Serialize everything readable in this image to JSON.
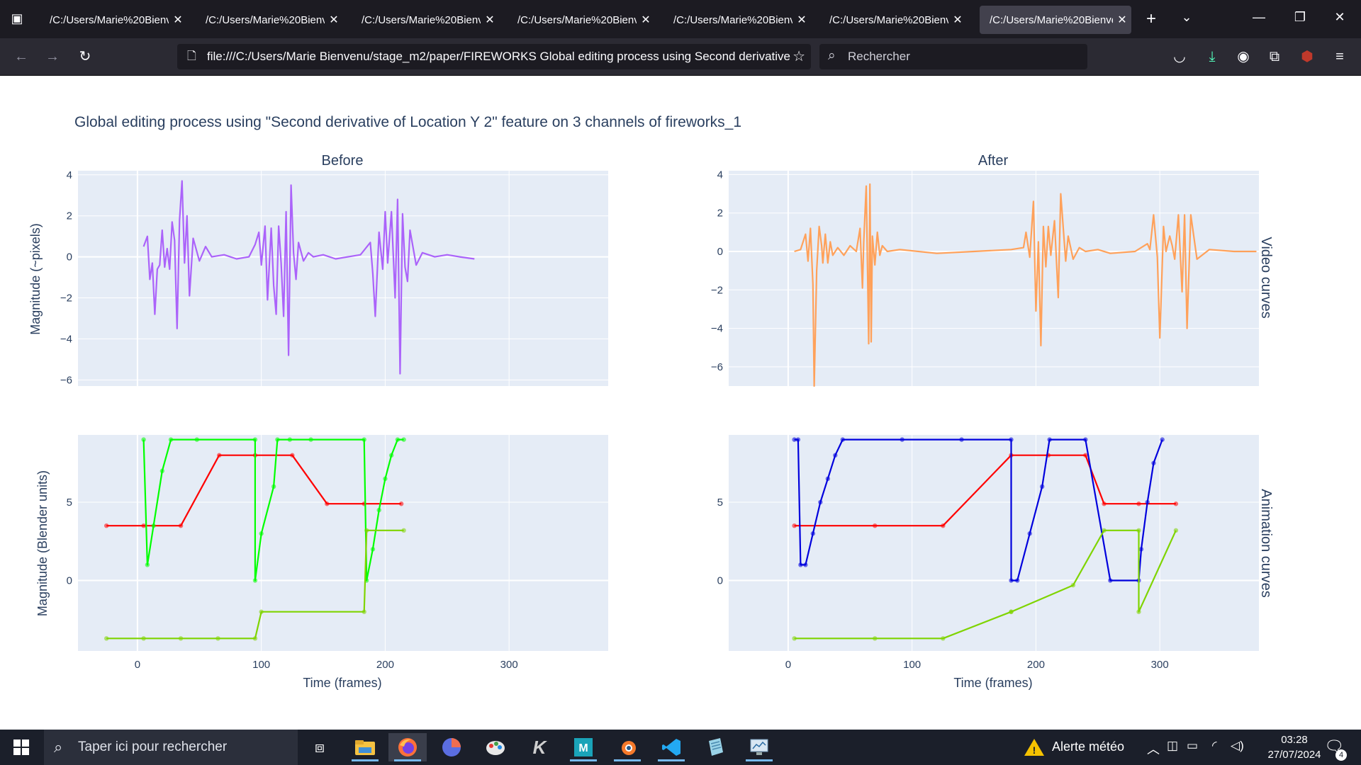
{
  "tabs": [
    {
      "label": "/C:/Users/Marie%20Bienve"
    },
    {
      "label": "/C:/Users/Marie%20Bienve"
    },
    {
      "label": "/C:/Users/Marie%20Bienve"
    },
    {
      "label": "/C:/Users/Marie%20Bienve"
    },
    {
      "label": "/C:/Users/Marie%20Bienve"
    },
    {
      "label": "/C:/Users/Marie%20Bienve"
    },
    {
      "label": "/C:/Users/Marie%20Bienve"
    }
  ],
  "active_tab_index": 6,
  "nav": {
    "url": "file:///C:/Users/Marie Bienvenu/stage_m2/paper/FIREWORKS Global editing process using Second derivative",
    "search_placeholder": "Rechercher"
  },
  "figure": {
    "title": "Global editing process using \"Second derivative of Location Y 2\" feature on 3 channels of fireworks_1",
    "col_titles": [
      "Before",
      "After"
    ],
    "row_titles": [
      "Video curves",
      "Animation curves"
    ],
    "ylabel_top": "Magnitude (~pixels)",
    "ylabel_bottom": "Magnitude (Blender units)",
    "xlabel": "Time (frames)"
  },
  "chart_data": [
    {
      "type": "line",
      "panel": "Before / Video curves",
      "color": "#ab63fa",
      "xlim": [
        -48,
        380
      ],
      "ylim": [
        -6.3,
        4.2
      ],
      "xticks": [
        0,
        100,
        200,
        300
      ],
      "yticks": [
        -6,
        -4,
        -2,
        0,
        2,
        4
      ],
      "series": [
        {
          "x": [
            5,
            8,
            10,
            12,
            14,
            16,
            18,
            20,
            22,
            24,
            26,
            28,
            30,
            32,
            34,
            36,
            38,
            40,
            42,
            45,
            50,
            55,
            60,
            70,
            80,
            90,
            95,
            98,
            100,
            103,
            105,
            108,
            110,
            112,
            114,
            116,
            118,
            120,
            122,
            124,
            126,
            128,
            130,
            134,
            138,
            142,
            150,
            160,
            170,
            180,
            188,
            190,
            192,
            195,
            198,
            200,
            202,
            205,
            208,
            210,
            212,
            214,
            216,
            218,
            220,
            225,
            230,
            240,
            250,
            260,
            272
          ],
          "y": [
            0.5,
            1.0,
            -1.1,
            -0.3,
            -2.8,
            -0.6,
            -0.4,
            1.3,
            -0.5,
            0.4,
            -0.6,
            1.7,
            0.8,
            -3.5,
            1.8,
            3.7,
            -0.3,
            2.0,
            -1.9,
            0.9,
            -0.2,
            0.5,
            0.0,
            0.1,
            -0.1,
            0.0,
            0.6,
            1.2,
            -0.4,
            1.5,
            -2.1,
            1.4,
            -1.4,
            -2.8,
            1.5,
            -0.3,
            -2.9,
            2.2,
            -4.8,
            3.5,
            0.2,
            -1.1,
            0.7,
            -0.2,
            0.2,
            0.0,
            0.1,
            -0.1,
            0.0,
            0.1,
            0.7,
            -0.8,
            -2.9,
            1.2,
            -0.6,
            2.2,
            -0.3,
            2.2,
            -2.0,
            2.8,
            -5.7,
            2.1,
            -0.5,
            -1.2,
            1.3,
            -0.4,
            0.2,
            0.0,
            0.1,
            0.0,
            -0.1
          ]
        }
      ]
    },
    {
      "type": "line",
      "panel": "After / Video curves",
      "color": "#ffa15a",
      "xlim": [
        -48,
        380
      ],
      "ylim": [
        -7.0,
        4.2
      ],
      "xticks": [
        0,
        100,
        200,
        300
      ],
      "yticks": [
        -6,
        -4,
        -2,
        0,
        2,
        4
      ],
      "series": [
        {
          "x": [
            5,
            10,
            14,
            16,
            18,
            20,
            21,
            23,
            25,
            27,
            28,
            30,
            32,
            34,
            36,
            40,
            45,
            50,
            55,
            58,
            60,
            61,
            63,
            65,
            66,
            67,
            68,
            70,
            72,
            74,
            76,
            80,
            90,
            120,
            150,
            180,
            190,
            192,
            195,
            198,
            200,
            202,
            204,
            206,
            208,
            210,
            212,
            215,
            218,
            220,
            224,
            226,
            230,
            235,
            240,
            250,
            260,
            280,
            290,
            292,
            295,
            298,
            300,
            303,
            305,
            308,
            310,
            312,
            315,
            318,
            320,
            322,
            325,
            330,
            340,
            360,
            378
          ],
          "y": [
            0,
            0.1,
            0.9,
            -0.5,
            1.2,
            -1.7,
            -7.0,
            -1.0,
            1.3,
            0.3,
            -0.6,
            0.9,
            -0.6,
            0.5,
            -0.2,
            0.2,
            -0.2,
            0.3,
            0.0,
            1.2,
            -1.9,
            0.5,
            3.4,
            -4.8,
            3.5,
            -4.7,
            0.8,
            -0.7,
            1.0,
            -0.2,
            0.3,
            0.0,
            0.1,
            -0.1,
            0.0,
            0.1,
            0.2,
            1.0,
            -0.3,
            2.6,
            -3.1,
            0.5,
            -4.9,
            1.3,
            -0.8,
            1.3,
            -0.2,
            1.6,
            -2.4,
            3.0,
            -0.5,
            0.8,
            -0.4,
            0.2,
            0.0,
            0.1,
            -0.1,
            0.0,
            0.4,
            0.1,
            1.9,
            -0.3,
            -4.5,
            1.3,
            0.0,
            0.8,
            0.3,
            -0.4,
            1.9,
            -2.1,
            1.9,
            -4.0,
            1.9,
            -0.4,
            0.1,
            0.0,
            0.0
          ]
        }
      ]
    },
    {
      "type": "line",
      "panel": "Before / Animation curves",
      "xlim": [
        -48,
        380
      ],
      "ylim": [
        -4.5,
        9.3
      ],
      "xticks": [
        0,
        100,
        200,
        300
      ],
      "yticks": [
        0,
        5
      ],
      "series": [
        {
          "color": "#ff0000",
          "x": [
            -25,
            5,
            35,
            66,
            95,
            125,
            153,
            183,
            213
          ],
          "y": [
            3.5,
            3.5,
            3.5,
            8.0,
            8.0,
            8.0,
            4.9,
            4.9,
            4.9
          ]
        },
        {
          "color": "#00ff00",
          "x": [
            5,
            8,
            13,
            20,
            27,
            48,
            95,
            95,
            100,
            110,
            113,
            123,
            140,
            183,
            185,
            190,
            195,
            200,
            205,
            210,
            215
          ],
          "y": [
            9.0,
            1.0,
            3.5,
            7.0,
            9.0,
            9.0,
            9.0,
            0,
            3.0,
            6.0,
            9.0,
            9.0,
            9.0,
            9.0,
            0,
            2.0,
            4.5,
            6.5,
            8.0,
            9.0,
            9.0
          ]
        },
        {
          "color": "#7fd400",
          "x": [
            -25,
            5,
            35,
            65,
            95,
            100,
            183,
            185,
            215
          ],
          "y": [
            -3.7,
            -3.7,
            -3.7,
            -3.7,
            -3.7,
            -2.0,
            -2.0,
            3.2,
            3.2
          ]
        }
      ]
    },
    {
      "type": "line",
      "panel": "After / Animation curves",
      "xlim": [
        -48,
        380
      ],
      "ylim": [
        -4.5,
        9.3
      ],
      "xticks": [
        0,
        100,
        200,
        300
      ],
      "yticks": [
        0,
        5
      ],
      "series": [
        {
          "color": "#ff0000",
          "x": [
            5,
            70,
            125,
            180,
            210,
            240,
            255,
            283,
            313
          ],
          "y": [
            3.5,
            3.5,
            3.5,
            8.0,
            8.0,
            8.0,
            4.9,
            4.9,
            4.9
          ]
        },
        {
          "color": "#0000dd",
          "x": [
            5,
            8,
            10,
            14,
            20,
            26,
            32,
            38,
            44,
            92,
            140,
            180,
            180,
            185,
            195,
            205,
            211,
            240,
            260,
            283,
            285,
            290,
            295,
            302
          ],
          "y": [
            9.0,
            9.0,
            1.0,
            1.0,
            3.0,
            5.0,
            6.5,
            8.0,
            9.0,
            9.0,
            9.0,
            9.0,
            0,
            0,
            3.0,
            6.0,
            9.0,
            9.0,
            0,
            0,
            2.0,
            5.0,
            7.5,
            9.0
          ]
        },
        {
          "color": "#7fd400",
          "x": [
            5,
            70,
            125,
            180,
            180,
            230,
            255,
            283,
            283,
            313
          ],
          "y": [
            -3.7,
            -3.7,
            -3.7,
            -2.0,
            -2.0,
            -0.3,
            3.2,
            3.2,
            -2.0,
            3.2
          ]
        }
      ]
    }
  ],
  "taskbar": {
    "search_placeholder": "Taper ici pour rechercher",
    "weather": "Alerte météo",
    "time": "03:28",
    "date": "27/07/2024",
    "notif_count": "4"
  }
}
